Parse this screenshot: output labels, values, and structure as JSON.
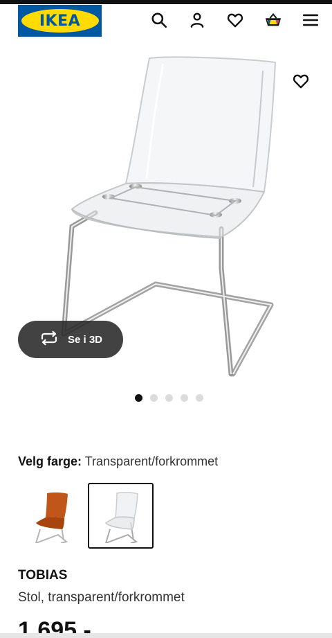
{
  "header": {
    "logo_text": "IKEA",
    "icons": [
      "search-icon",
      "profile-icon",
      "heart-icon",
      "basket-icon",
      "menu-icon"
    ]
  },
  "gallery": {
    "button_3d_label": "Se i 3D",
    "total_images": 5,
    "active_index": 1
  },
  "color": {
    "label": "Velg farge:",
    "value": "Transparent/forkrommet",
    "swatches": [
      {
        "name": "orange",
        "color": "#c0561a",
        "selected": false
      },
      {
        "name": "transparent",
        "color": "#ffffff",
        "selected": true
      }
    ]
  },
  "product": {
    "name": "TOBIAS",
    "description": "Stol, transparent/forkrommet",
    "price": "1.695,-"
  },
  "colors": {
    "ikea_blue": "#0058a3",
    "ikea_yellow": "#ffdb00"
  }
}
